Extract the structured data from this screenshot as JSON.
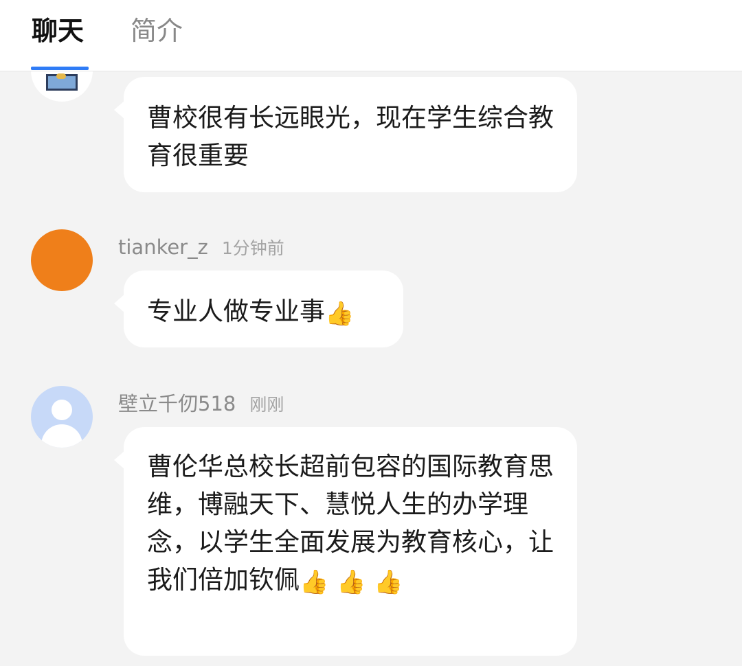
{
  "tabs": {
    "chat": "聊天",
    "intro": "简介"
  },
  "messages": [
    {
      "username": "",
      "time": "",
      "text": "曹校很有长远眼光，现在学生综合教育很重要"
    },
    {
      "username": "tianker_z",
      "time": "1分钟前",
      "text": "专业人做专业事"
    },
    {
      "username": "壁立千仞518",
      "time": "刚刚",
      "text": "曹伦华总校长超前包容的国际教育思维，博融天下、慧悦人生的办学理念，以学生全面发展为教育核心，让我们倍加钦佩"
    }
  ],
  "emoji": {
    "thumbs_up": "👍"
  },
  "colors": {
    "accent": "#2f7cf6",
    "avatar_orange": "#ef7f1a",
    "avatar_default": "#c7d9f8",
    "background": "#f3f3f3"
  },
  "icons": [
    "thumbs-up-icon",
    "default-avatar-icon"
  ]
}
